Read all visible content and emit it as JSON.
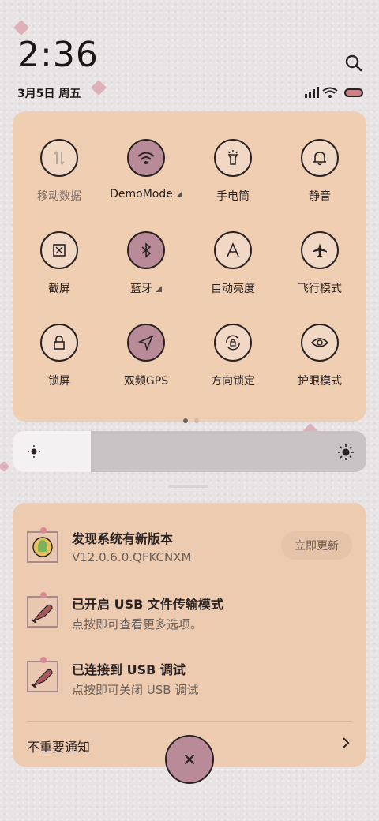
{
  "status": {
    "time": "2:36",
    "date": "3月5日 周五"
  },
  "quick_settings": {
    "tiles": [
      {
        "label": "移动数据",
        "icon": "mobile-data-icon",
        "active": false
      },
      {
        "label": "DemoMode",
        "icon": "wifi-icon",
        "active": true
      },
      {
        "label": "手电筒",
        "icon": "flashlight-icon",
        "active": false
      },
      {
        "label": "静音",
        "icon": "bell-icon",
        "active": false
      },
      {
        "label": "截屏",
        "icon": "screenshot-icon",
        "active": false
      },
      {
        "label": "蓝牙",
        "icon": "bluetooth-icon",
        "active": true
      },
      {
        "label": "自动亮度",
        "icon": "auto-brightness-icon",
        "active": false
      },
      {
        "label": "飞行模式",
        "icon": "airplane-icon",
        "active": false
      },
      {
        "label": "锁屏",
        "icon": "lock-icon",
        "active": false
      },
      {
        "label": "双频GPS",
        "icon": "gps-icon",
        "active": true
      },
      {
        "label": "方向锁定",
        "icon": "rotation-lock-icon",
        "active": false
      },
      {
        "label": "护眼模式",
        "icon": "eye-icon",
        "active": false
      }
    ],
    "page_count": 2,
    "current_page": 1
  },
  "brightness": {
    "level": 0.22
  },
  "notifications": {
    "items": [
      {
        "title": "发现系统有新版本",
        "subtitle": "V12.0.6.0.QFKCNXM",
        "action": "立即更新",
        "icon": "android-update-icon"
      },
      {
        "title": "已开启 USB 文件传输模式",
        "subtitle": "点按即可查看更多选项。",
        "icon": "usb-icon"
      },
      {
        "title": "已连接到 USB 调试",
        "subtitle": "点按即可关闭 USB 调试",
        "icon": "usb-debug-icon"
      }
    ],
    "unimportant_label": "不重要通知"
  },
  "colors": {
    "accent": "#b98a98",
    "panel": "#efceb1",
    "text": "#2a2222"
  }
}
